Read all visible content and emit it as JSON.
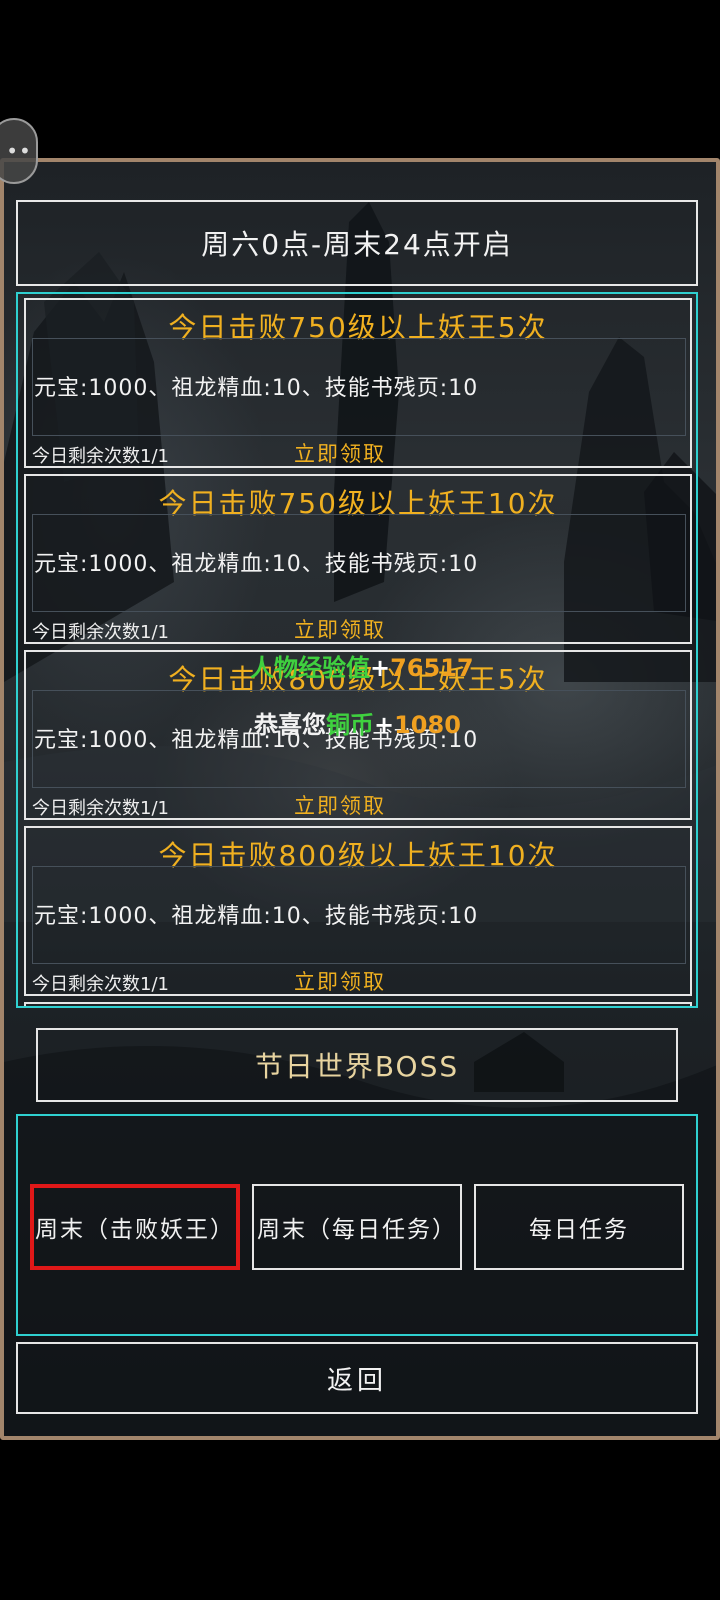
{
  "floating_button": {
    "icon": "chat-bubble-icon",
    "glyph": "••"
  },
  "header": {
    "title": "周六0点-周末24点开启"
  },
  "tasks": [
    {
      "title": "今日击败750级以上妖王5次",
      "reward": "元宝:1000、祖龙精血:10、技能书残页:10",
      "remaining": "今日剩余次数1/1",
      "claim_label": "立即领取"
    },
    {
      "title": "今日击败750级以上妖王10次",
      "reward": "元宝:1000、祖龙精血:10、技能书残页:10",
      "remaining": "今日剩余次数1/1",
      "claim_label": "立即领取"
    },
    {
      "title": "今日击败800级以上妖王5次",
      "reward": "元宝:1000、祖龙精血:10、技能书残页:10",
      "remaining": "今日剩余次数1/1",
      "claim_label": "立即领取"
    },
    {
      "title": "今日击败800级以上妖王10次",
      "reward": "元宝:1000、祖龙精血:10、技能书残页:10",
      "remaining": "今日剩余次数1/1",
      "claim_label": "立即领取"
    }
  ],
  "notification": {
    "exp_label": "人物经验值",
    "exp_plus": "+",
    "exp_value": "76517",
    "coin_prefix": "恭喜您",
    "coin_label": "铜币",
    "coin_plus": "+",
    "coin_value": "1080"
  },
  "boss_button": {
    "label": "节日世界BOSS"
  },
  "tabs": [
    {
      "label": "周末（击败妖王）",
      "selected": true
    },
    {
      "label": "周末（每日任务）",
      "selected": false
    },
    {
      "label": "每日任务",
      "selected": false
    }
  ],
  "back_button": {
    "label": "返回"
  },
  "colors": {
    "gold": "#f0b020",
    "cyan_border": "#2fd0d0",
    "panel_border": "#a2856b",
    "selected_red": "#e01818",
    "green": "#3fd13f"
  }
}
